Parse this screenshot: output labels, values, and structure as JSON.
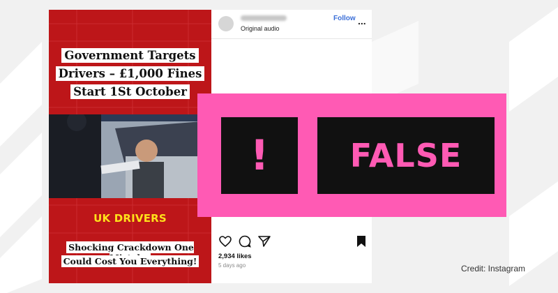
{
  "post": {
    "video": {
      "headline_line1": "Government Targets",
      "headline_line2": "Drivers – £1,000 Fines",
      "headline_line3": "Start 1St October",
      "label": "UK DRIVERS",
      "bottom_line1": "Shocking Crackdown One Mistake",
      "bottom_line2": "Could Cost You Everything!"
    },
    "header": {
      "subtitle": "Original audio",
      "follow_label": "Follow",
      "more_label": "..."
    },
    "actions": {
      "like_icon": "heart-icon",
      "comment_icon": "comment-icon",
      "share_icon": "share-icon",
      "save_icon": "bookmark-icon"
    },
    "likes": "2,934 likes",
    "date": "5 days ago"
  },
  "verdict": {
    "symbol": "!",
    "label": "FALSE",
    "colors": {
      "banner": "#ff5ab4",
      "box": "#111111"
    }
  },
  "credit": "Credit: Instagram"
}
